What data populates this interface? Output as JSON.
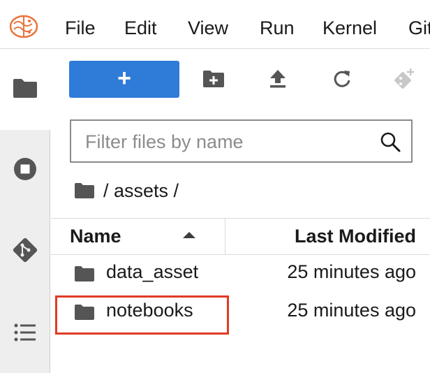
{
  "menubar": {
    "logo_icon": "jupyter-brain-logo",
    "items": [
      "File",
      "Edit",
      "View",
      "Run",
      "Kernel",
      "Git"
    ]
  },
  "sidebar": {
    "tabs": [
      {
        "icon": "folder-icon",
        "active": true
      },
      {
        "icon": "running-stop-icon",
        "active": false
      },
      {
        "icon": "git-icon",
        "active": false
      },
      {
        "icon": "table-of-contents-icon",
        "active": false
      }
    ]
  },
  "toolbar": {
    "new_label": "+",
    "buttons": [
      "new-folder-icon",
      "upload-icon",
      "refresh-icon",
      "git-clone-icon"
    ]
  },
  "filter": {
    "placeholder": "Filter files by name",
    "value": ""
  },
  "breadcrumb": {
    "path": "/ assets /"
  },
  "table": {
    "columns": {
      "name": "Name",
      "modified": "Last Modified"
    },
    "sort": "name-ascending",
    "rows": [
      {
        "name": "data_asset",
        "modified": "25 minutes ago",
        "type": "folder"
      },
      {
        "name": "notebooks",
        "modified": "25 minutes ago",
        "type": "folder",
        "highlighted": true
      }
    ]
  },
  "colors": {
    "accent": "#2f7bd8",
    "highlight": "#e03b24",
    "icon": "#555555"
  }
}
